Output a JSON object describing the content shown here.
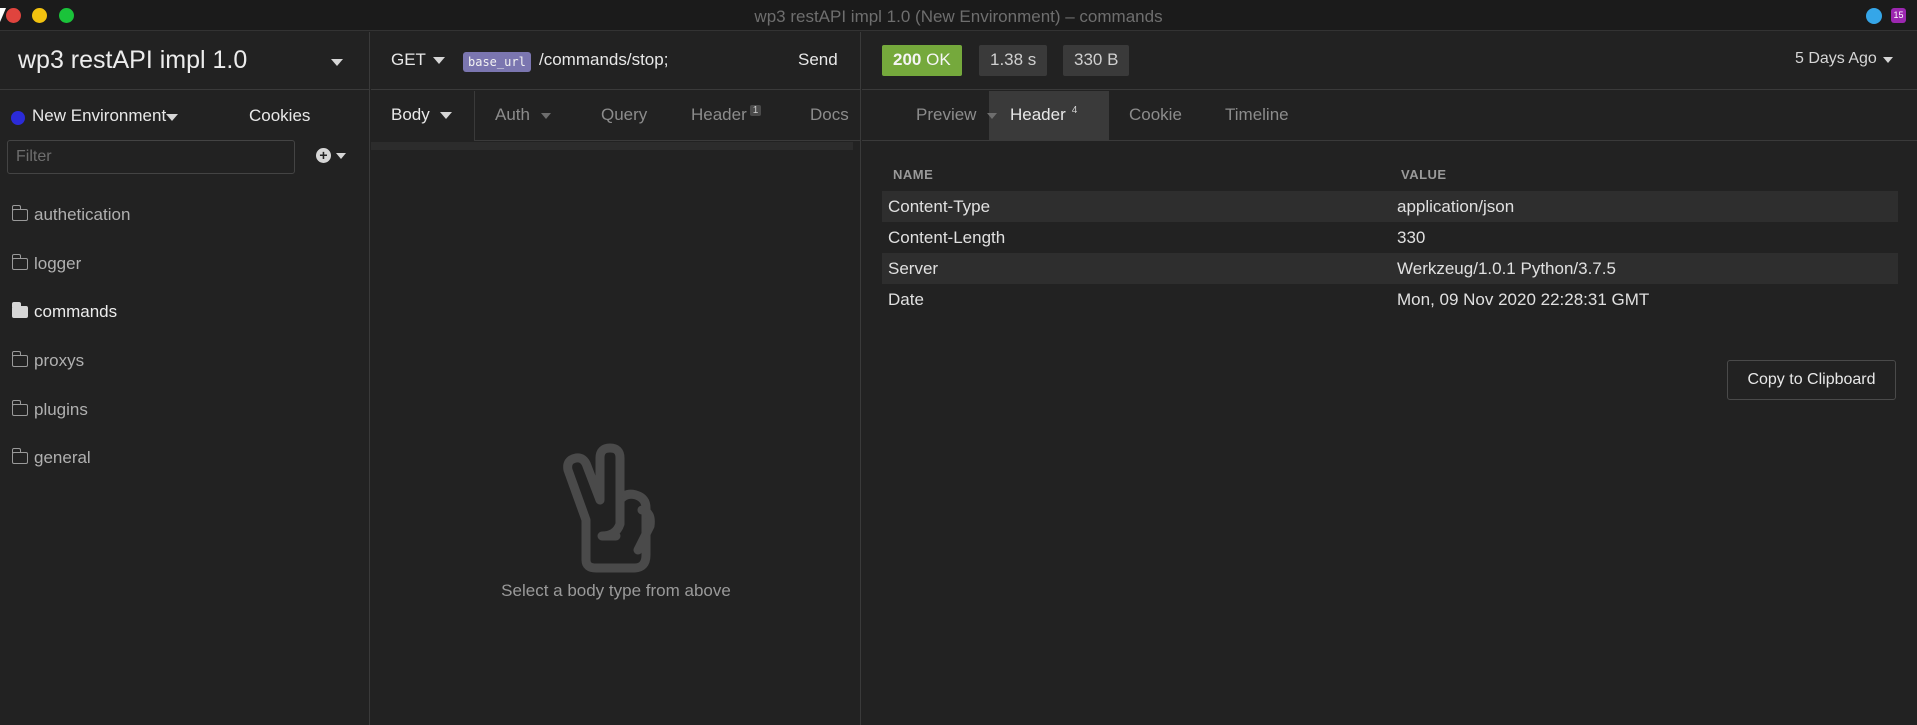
{
  "window": {
    "title": "wp3 restAPI impl 1.0 (New Environment) – commands",
    "tray_badge": "15"
  },
  "sidebar": {
    "workspace_title": "wp3 restAPI impl 1.0",
    "environment": "New Environment",
    "environment_color": "#2b2bd8",
    "cookies_label": "Cookies",
    "filter_placeholder": "Filter",
    "folders": [
      {
        "label": "authetication",
        "icon": "folder-icon",
        "active": false
      },
      {
        "label": "logger",
        "icon": "folder-icon",
        "active": false
      },
      {
        "label": "commands",
        "icon": "folder-open-icon",
        "active": true
      },
      {
        "label": "proxys",
        "icon": "folder-icon",
        "active": false
      },
      {
        "label": "plugins",
        "icon": "folder-icon",
        "active": false
      },
      {
        "label": "general",
        "icon": "folder-icon",
        "active": false
      }
    ]
  },
  "request": {
    "method": "GET",
    "base_url_tag": "base_url",
    "path": "/commands/stop;",
    "send_label": "Send",
    "tabs": [
      {
        "label": "Body",
        "active": true
      },
      {
        "label": "Auth",
        "active": false
      },
      {
        "label": "Query",
        "active": false
      },
      {
        "label": "Header",
        "badge": "1",
        "active": false
      },
      {
        "label": "Docs",
        "active": false
      }
    ],
    "empty_message": "Select a body type from above",
    "empty_icon": "peace-hand-icon"
  },
  "response": {
    "status_code": "200",
    "status_text": "OK",
    "status_color": "#75a93c",
    "time": "1.38 s",
    "size": "330 B",
    "time_ago": "5 Days Ago",
    "tabs": [
      {
        "label": "Preview",
        "active": false
      },
      {
        "label": "Header",
        "badge": "4",
        "active": true
      },
      {
        "label": "Cookie",
        "active": false
      },
      {
        "label": "Timeline",
        "active": false
      }
    ],
    "headers_table": {
      "columns": [
        "NAME",
        "VALUE"
      ],
      "rows": [
        {
          "name": "Content-Type",
          "value": "application/json"
        },
        {
          "name": "Content-Length",
          "value": "330"
        },
        {
          "name": "Server",
          "value": "Werkzeug/1.0.1 Python/3.7.5"
        },
        {
          "name": "Date",
          "value": "Mon, 09 Nov 2020 22:28:31 GMT"
        }
      ]
    },
    "copy_label": "Copy to Clipboard"
  }
}
